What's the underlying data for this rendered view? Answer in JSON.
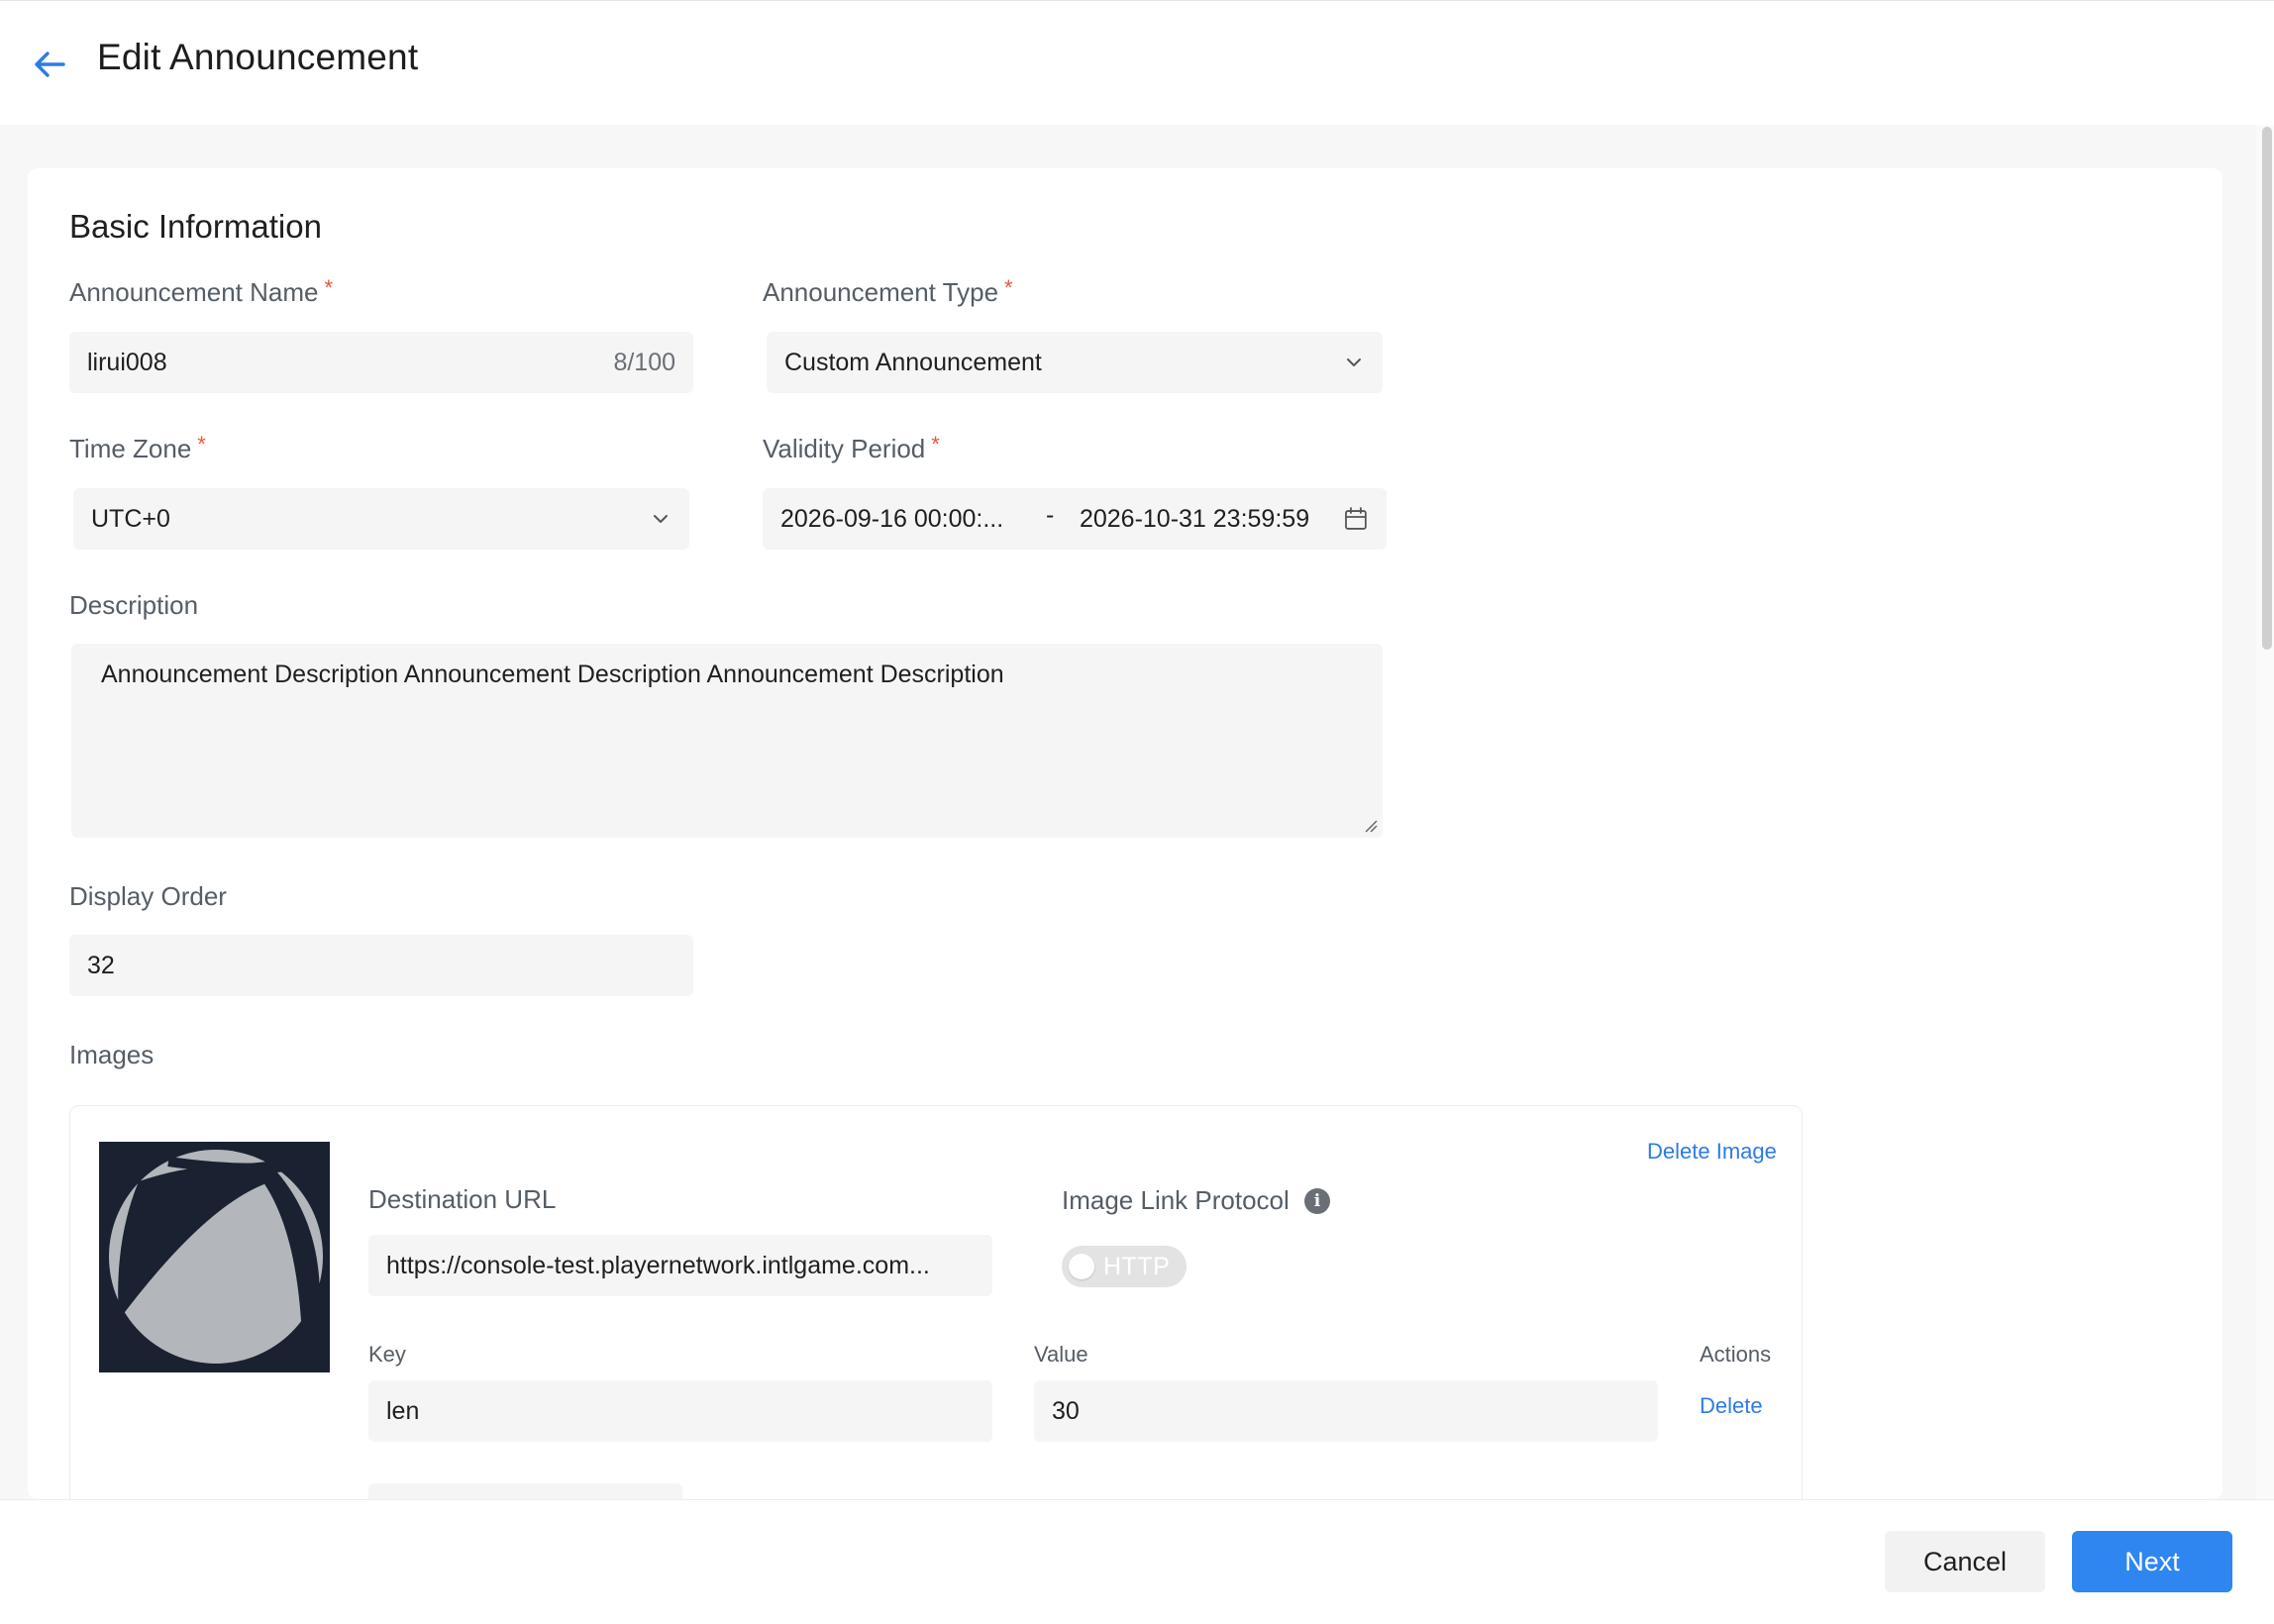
{
  "header": {
    "title": "Edit Announcement"
  },
  "basic": {
    "title": "Basic Information",
    "name_label": "Announcement Name",
    "name_value": "lirui008",
    "name_counter": "8/100",
    "type_label": "Announcement Type",
    "type_value": "Custom Announcement",
    "tz_label": "Time Zone",
    "tz_value": "UTC+0",
    "validity_label": "Validity Period",
    "validity_start": "2026-09-16 00:00:...",
    "validity_sep": "-",
    "validity_end": "2026-10-31 23:59:59",
    "desc_label": "Description",
    "desc_value": "Announcement Description Announcement Description Announcement Description",
    "order_label": "Display Order",
    "order_value": "32",
    "required_mark": "*"
  },
  "images": {
    "label": "Images",
    "delete_image": "Delete Image",
    "dest_label": "Destination URL",
    "dest_value": "https://console-test.playernetwork.intlgame.com...",
    "protocol_label": "Image Link Protocol",
    "protocol_value": "HTTP",
    "protocol_on": false,
    "info_glyph": "i",
    "key_label": "Key",
    "value_label": "Value",
    "actions_label": "Actions",
    "params": [
      {
        "key": "len",
        "value": "30",
        "action": "Delete"
      }
    ]
  },
  "footer": {
    "cancel": "Cancel",
    "next": "Next"
  },
  "colors": {
    "primary": "#2f86f0",
    "link": "#2d7be5",
    "required": "#e8573a"
  },
  "icons": [
    "back-arrow-icon",
    "chevron-down-icon",
    "calendar-icon",
    "info-icon",
    "resize-grip-icon"
  ]
}
